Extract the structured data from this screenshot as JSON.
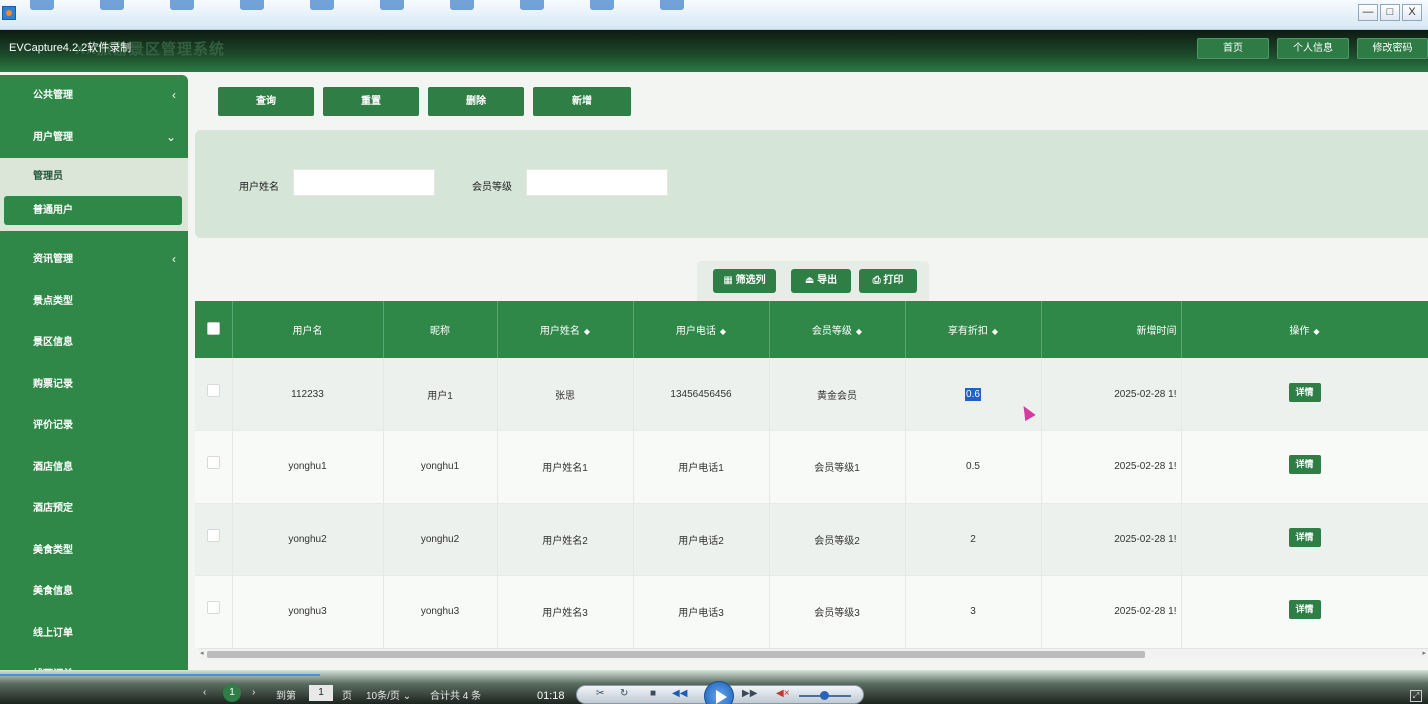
{
  "recorder": {
    "title": "EVCapture4.2.2软件录制",
    "time": "01:18",
    "window_buttons": [
      "—",
      "□",
      "X"
    ]
  },
  "app": {
    "title": "XX旅游景区管理系统",
    "header_buttons": [
      "首页",
      "个人信息",
      "修改密码"
    ]
  },
  "sidebar": {
    "public": {
      "label": "公共管理",
      "chevron": "‹"
    },
    "user_mgmt": {
      "label": "用户管理",
      "chevron": "⌄"
    },
    "user_sub": [
      "管理员",
      "普通用户"
    ],
    "news": {
      "label": "资讯管理",
      "chevron": "‹"
    },
    "items": [
      "景点类型",
      "景区信息",
      "购票记录",
      "评价记录",
      "酒店信息",
      "酒店预定",
      "美食类型",
      "美食信息",
      "线上订单",
      "线下订单"
    ]
  },
  "toolbar": {
    "query": "查询",
    "reset": "重置",
    "delete": "删除",
    "add": "新增"
  },
  "filter": {
    "name_label": "用户姓名",
    "name_value": "",
    "level_label": "会员等级",
    "level_value": ""
  },
  "table_actions": {
    "filter_cols": "筛选列",
    "export": "导出",
    "print": "打印"
  },
  "table": {
    "headers": {
      "username": "用户名",
      "nickname": "昵称",
      "realname": "用户姓名",
      "phone": "用户电话",
      "level": "会员等级",
      "discount": "享有折扣",
      "created": "新增时间",
      "ops": "操作"
    },
    "sort_icon": "◆",
    "detail_label": "详情",
    "rows": [
      {
        "username": "112233",
        "nickname": "用户1",
        "realname": "张思",
        "phone": "13456456456",
        "level": "黄金会员",
        "discount": "0.6",
        "created": "2025-02-28 1!"
      },
      {
        "username": "yonghu1",
        "nickname": "yonghu1",
        "realname": "用户姓名1",
        "phone": "用户电话1",
        "level": "会员等级1",
        "discount": "0.5",
        "created": "2025-02-28 1!"
      },
      {
        "username": "yonghu2",
        "nickname": "yonghu2",
        "realname": "用户姓名2",
        "phone": "用户电话2",
        "level": "会员等级2",
        "discount": "2",
        "created": "2025-02-28 1!"
      },
      {
        "username": "yonghu3",
        "nickname": "yonghu3",
        "realname": "用户姓名3",
        "phone": "用户电话3",
        "level": "会员等级3",
        "discount": "3",
        "created": "2025-02-28 1!"
      }
    ]
  },
  "pagination": {
    "current": "1",
    "goto_label": "到第",
    "goto_value": "1",
    "page_label": "页",
    "page_size": "10条/页",
    "total": "合计共 4 条"
  }
}
